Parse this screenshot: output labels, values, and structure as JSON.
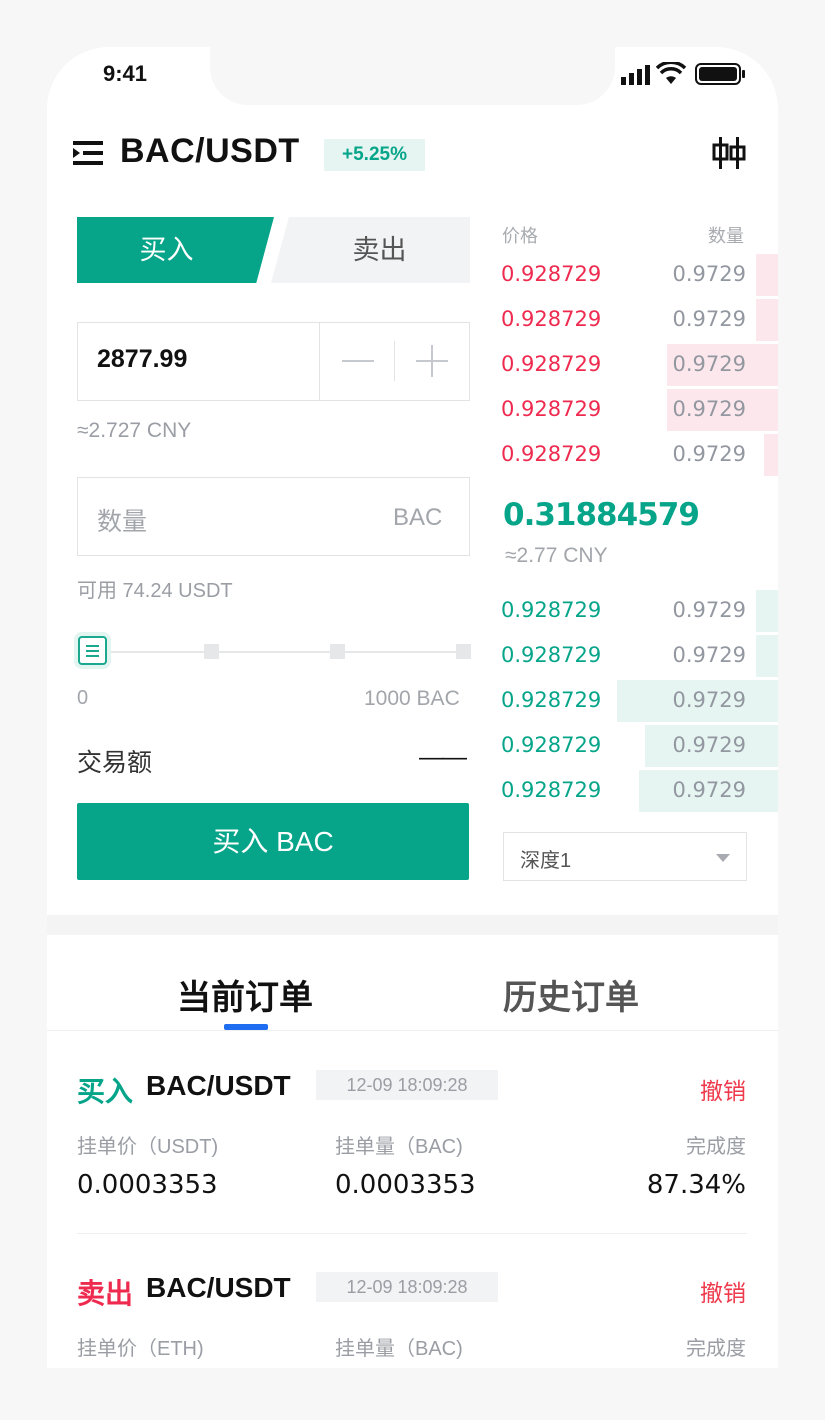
{
  "status_bar": {
    "time": "9:41"
  },
  "header": {
    "pair": "BAC/USDT",
    "change": "+5.25%",
    "kline_icon": "candlestick-icon",
    "menu_icon": "menu-icon"
  },
  "trade_tabs": {
    "buy": "买入",
    "sell": "卖出"
  },
  "price_input": {
    "value": "2877.99",
    "cny": "≈2.727 CNY"
  },
  "amount_input": {
    "placeholder": "数量",
    "unit": "BAC"
  },
  "available": "可用 74.24 USDT",
  "slider": {
    "min": "0",
    "max": "1000 BAC",
    "value": 0
  },
  "trade_amount": {
    "label": "交易额",
    "value": "——"
  },
  "submit": "买入 BAC",
  "order_book": {
    "header_price": "价格",
    "header_qty": "数量",
    "asks": [
      {
        "price": "0.928729",
        "qty": "0.9729",
        "depth": 0.08
      },
      {
        "price": "0.928729",
        "qty": "0.9729",
        "depth": 0.08
      },
      {
        "price": "0.928729",
        "qty": "0.9729",
        "depth": 0.4
      },
      {
        "price": "0.928729",
        "qty": "0.9729",
        "depth": 0.4
      },
      {
        "price": "0.928729",
        "qty": "0.9729",
        "depth": 0.05
      }
    ],
    "last_price": "0.31884579",
    "last_cny": "≈2.77 CNY",
    "bids": [
      {
        "price": "0.928729",
        "qty": "0.9729",
        "depth": 0.08
      },
      {
        "price": "0.928729",
        "qty": "0.9729",
        "depth": 0.08
      },
      {
        "price": "0.928729",
        "qty": "0.9729",
        "depth": 0.58
      },
      {
        "price": "0.928729",
        "qty": "0.9729",
        "depth": 0.48
      },
      {
        "price": "0.928729",
        "qty": "0.9729",
        "depth": 0.5
      }
    ],
    "depth_select": "深度1"
  },
  "orders_tabs": {
    "current": "当前订单",
    "history": "历史订单"
  },
  "orders": [
    {
      "side": "买入",
      "side_color": "#06a58a",
      "pair": "BAC/USDT",
      "time": "12-09 18:09:28",
      "cancel": "撤销",
      "label1": "挂单价（USDT)",
      "label2": "挂单量（BAC)",
      "label3": "完成度",
      "value1": "0.0003353",
      "value2": "0.0003353",
      "value3": "87.34%"
    },
    {
      "side": "卖出",
      "side_color": "#ee2b4f",
      "pair": "BAC/USDT",
      "time": "12-09 18:09:28",
      "cancel": "撤销",
      "label1": "挂单价（ETH)",
      "label2": "挂单量（BAC)",
      "label3": "完成度",
      "value1": "",
      "value2": "",
      "value3": ""
    }
  ],
  "colors": {
    "accent": "#06a58a",
    "ask": "#ee2b4f",
    "ask_bg": "#fce8ec",
    "bid_bg": "#e6f5f2",
    "tab_indicator": "#1f6ef2"
  }
}
